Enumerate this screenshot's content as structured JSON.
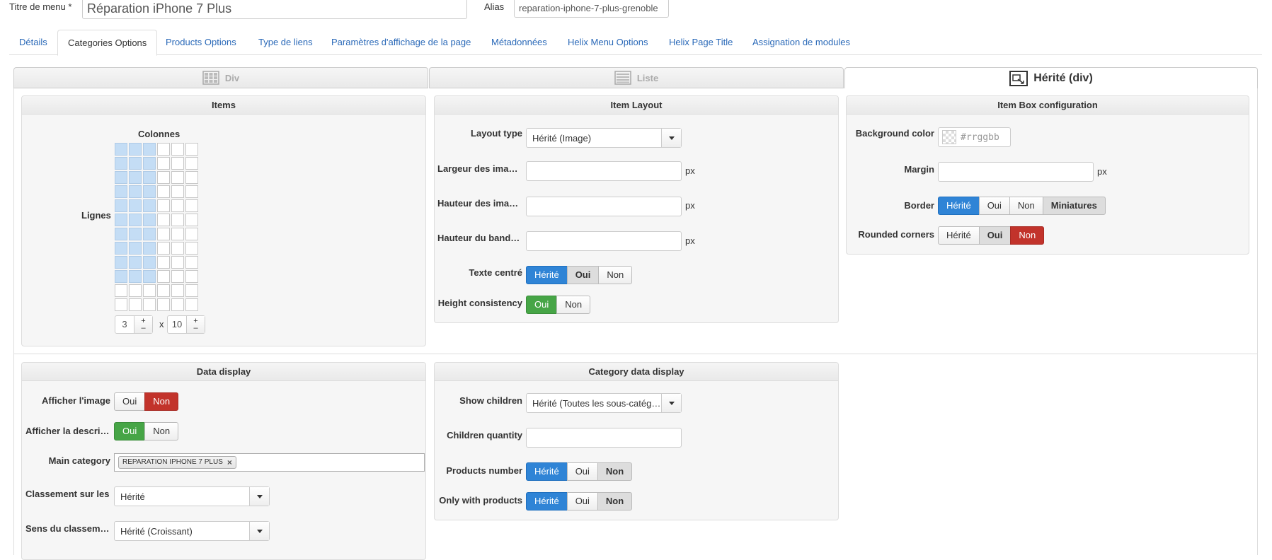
{
  "menu_title": {
    "label": "Titre de menu *",
    "value": "Réparation iPhone 7 Plus"
  },
  "alias": {
    "label": "Alias",
    "value": "reparation-iphone-7-plus-grenoble"
  },
  "tabs": [
    {
      "label": "Détails"
    },
    {
      "label": "Categories Options"
    },
    {
      "label": "Products Options"
    },
    {
      "label": "Type de liens"
    },
    {
      "label": "Paramètres d'affichage de la page"
    },
    {
      "label": "Métadonnées"
    },
    {
      "label": "Helix Menu Options"
    },
    {
      "label": "Helix Page Title"
    },
    {
      "label": "Assignation de modules"
    }
  ],
  "active_tab": "Categories Options",
  "layout_modes": {
    "div": "Div",
    "liste": "Liste",
    "herite": "Hérité (div)"
  },
  "items_panel": {
    "title": "Items",
    "colonnes_label": "Colonnes",
    "lignes_label": "Lignes",
    "columns_value": "3",
    "rows_value": "10",
    "times": "x",
    "grid_total_cols": 6,
    "grid_total_rows": 12,
    "plus": "+",
    "minus": "–"
  },
  "item_layout": {
    "title": "Item Layout",
    "layout_type_label": "Layout type",
    "layout_type_value": "Hérité (Image)",
    "largeur_label": "Largeur des images",
    "hauteur_img_label": "Hauteur des images",
    "hauteur_band_label": "Hauteur du bandeau",
    "unit": "px",
    "texte_centre_label": "Texte centré",
    "height_consistency_label": "Height consistency",
    "opt_herite": "Hérité",
    "opt_oui": "Oui",
    "opt_non": "Non"
  },
  "item_box": {
    "title": "Item Box configuration",
    "bg_label": "Background color",
    "bg_placeholder": "#rrggbb",
    "margin_label": "Margin",
    "unit": "px",
    "border_label": "Border",
    "border_miniatures": "Miniatures",
    "rounded_label": "Rounded corners",
    "opt_herite": "Hérité",
    "opt_oui": "Oui",
    "opt_non": "Non"
  },
  "data_display": {
    "title": "Data display",
    "afficher_image_label": "Afficher l'image",
    "afficher_descr_label": "Afficher la description",
    "main_category_label": "Main category",
    "main_category_tag": "REPARATION IPHONE 7 PLUS",
    "tag_remove": "×",
    "classement_label": "Classement sur les",
    "classement_value": "Hérité",
    "sens_label": "Sens du classement",
    "sens_value": "Hérité (Croissant)",
    "opt_oui": "Oui",
    "opt_non": "Non"
  },
  "category_display": {
    "title": "Category data display",
    "show_children_label": "Show children",
    "show_children_value": "Hérité (Toutes les sous-catégories)",
    "children_qty_label": "Children quantity",
    "products_number_label": "Products number",
    "only_with_products_label": "Only with products",
    "opt_herite": "Hérité",
    "opt_oui": "Oui",
    "opt_non": "Non"
  },
  "colors": {
    "primary": "#2f84d6",
    "success": "#46a546",
    "danger": "#c2332b",
    "link": "#2a69b8"
  }
}
